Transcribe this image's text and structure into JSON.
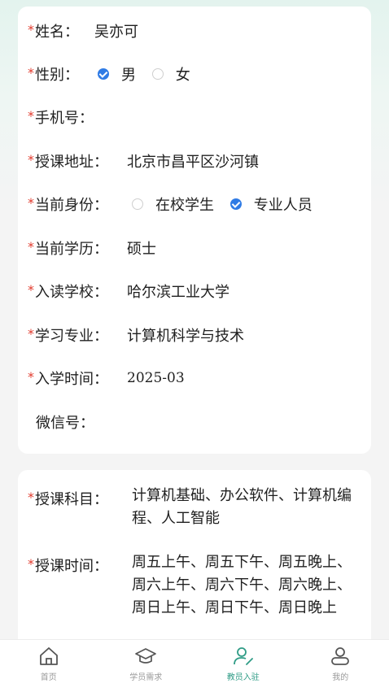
{
  "form": {
    "name": {
      "label": "姓名：",
      "value": "吴亦可",
      "required": true
    },
    "gender": {
      "label": "性别：",
      "options": [
        "男",
        "女"
      ],
      "selected": "男",
      "required": true
    },
    "phone": {
      "label": "手机号：",
      "value": "",
      "required": true
    },
    "address": {
      "label": "授课地址：",
      "value": "北京市昌平区沙河镇",
      "required": true
    },
    "identity": {
      "label": "当前身份：",
      "options": [
        "在校学生",
        "专业人员"
      ],
      "selected": "专业人员",
      "required": true
    },
    "education": {
      "label": "当前学历：",
      "value": "硕士",
      "required": true
    },
    "school": {
      "label": "入读学校：",
      "value": "哈尔滨工业大学",
      "required": true
    },
    "major": {
      "label": "学习专业：",
      "value": "计算机科学与技术",
      "required": true
    },
    "enroll_time": {
      "label": "入学时间：",
      "value": "2025-03",
      "required": true
    },
    "wechat": {
      "label": "微信号：",
      "value": "",
      "required": false
    }
  },
  "teaching": {
    "subjects": {
      "label": "授课科目：",
      "value": "计算机基础、办公软件、计算机编程、人工智能",
      "required": true
    },
    "times": {
      "label": "授课时间：",
      "value": "周五上午、周五下午、周五晚上、周六上午、周六下午、周六晚上、周日上午、周日下午、周日晚上",
      "required": true
    }
  },
  "tabbar": {
    "items": [
      {
        "label": "首页",
        "icon": "home-icon"
      },
      {
        "label": "学员需求",
        "icon": "graduation-cap-icon"
      },
      {
        "label": "教员入驻",
        "icon": "user-edit-icon",
        "active": true
      },
      {
        "label": "我的",
        "icon": "user-icon"
      }
    ]
  },
  "colors": {
    "accent": "#2f7be5",
    "active_tab": "#2f9c86",
    "required": "#e23b2e"
  }
}
